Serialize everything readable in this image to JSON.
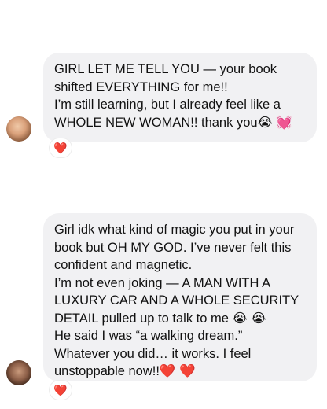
{
  "messages": [
    {
      "lines": [
        "GIRL LET ME TELL YOU — your book",
        "shifted EVERYTHING for me!!",
        "I’m still learning, but I already feel like a",
        "WHOLE NEW WOMAN!! thank you😭 💓"
      ],
      "reaction": "❤️"
    },
    {
      "lines": [
        "Girl idk what kind of magic you put in your",
        "book but OH MY GOD. I’ve never felt this",
        "confident and magnetic.",
        "I’m not even joking — A MAN WITH A",
        "LUXURY CAR AND A WHOLE SECURITY",
        "DETAIL pulled up to talk to me 😭 😭",
        "He said I was “a walking dream.”",
        "Whatever you did… it works. I feel",
        "unstoppable now!!❤️ ❤️"
      ],
      "reaction": "❤️"
    }
  ],
  "colors": {
    "bubble": "#f1f1f3",
    "text": "#111111",
    "reaction_heart": "#e0202a"
  }
}
